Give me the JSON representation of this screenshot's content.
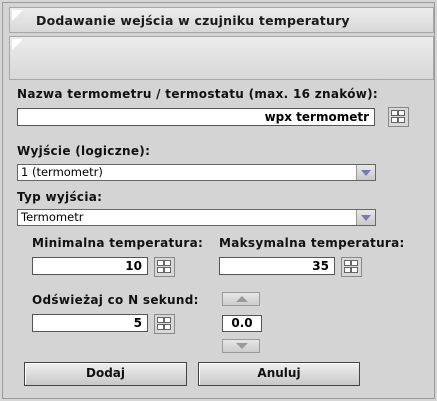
{
  "dialog": {
    "title": "Dodawanie wejścia w czujniku temperatury",
    "message": ""
  },
  "name_field": {
    "label": "Nazwa termometru / termostatu (max. 16 znaków):",
    "value": "wpx termometr"
  },
  "output_select": {
    "label": "Wyjście (logiczne):",
    "value": "1 (termometr)"
  },
  "output_type_select": {
    "label": "Typ wyjścia:",
    "value": "Termometr"
  },
  "min_temp": {
    "label": "Minimalna temperatura:",
    "value": "10"
  },
  "max_temp": {
    "label": "Maksymalna temperatura:",
    "value": "35"
  },
  "refresh": {
    "label": "Odświeżaj co N sekund:",
    "value": "5"
  },
  "spinner": {
    "value": "0.0"
  },
  "buttons": {
    "add": "Dodaj",
    "cancel": "Anuluj"
  }
}
